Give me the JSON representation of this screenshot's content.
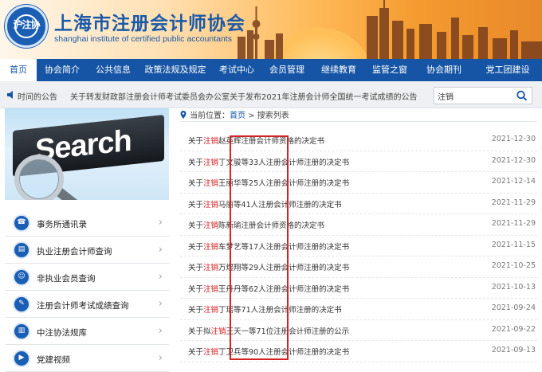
{
  "header": {
    "emblem_text": "沪注协",
    "title": "上海市注册会计师协会",
    "subtitle": "shanghai institute of certified public accountants",
    "colors": {
      "brand": "#1a5aa8",
      "banner_warm": "#f49a2e"
    }
  },
  "nav": {
    "items": [
      {
        "label": "首页",
        "active": true
      },
      {
        "label": "协会简介"
      },
      {
        "label": "公共信息"
      },
      {
        "label": "政策法规及规定"
      },
      {
        "label": "考试中心"
      },
      {
        "label": "会员管理"
      },
      {
        "label": "继续教育"
      },
      {
        "label": "监管之窗"
      },
      {
        "label": "协会期刊"
      },
      {
        "label": "党工团建设"
      }
    ],
    "bg_color": "#1655a5"
  },
  "notice": {
    "icon": "speaker-icon",
    "label": "时间的公告",
    "text": "关于转发财政部注册会计师考试委员会办公室关于发布2021年注册会计师全国统一考试成绩的公告"
  },
  "search": {
    "value": "注销",
    "icon": "search-icon"
  },
  "banner": {
    "word": "Search"
  },
  "left_menu": {
    "items": [
      {
        "label": "事务所通讯录",
        "icon": "address-book-icon",
        "glyph": "☎"
      },
      {
        "label": "执业注册会计师查询",
        "icon": "id-card-icon",
        "glyph": "▤"
      },
      {
        "label": "非执业会员查询",
        "icon": "user-icon",
        "glyph": "☺"
      },
      {
        "label": "注册会计师考试成绩查询",
        "icon": "document-icon",
        "glyph": "✎"
      },
      {
        "label": "中注协法规库",
        "icon": "book-icon",
        "glyph": "▥"
      },
      {
        "label": "党建视频",
        "icon": "video-icon",
        "glyph": "▶"
      }
    ]
  },
  "breadcrumb": {
    "prefix": "当前位置：",
    "home": "首页",
    "sep": " > ",
    "current": "搜索列表"
  },
  "results": {
    "highlight": "注销",
    "highlight_color": "#d41919",
    "items": [
      {
        "pre": "关于",
        "post": "赵英辉注册会计师资格的决定书",
        "date": "2021-12-30"
      },
      {
        "pre": "关于",
        "post": "丁文骏等33人注册会计师注册的决定书",
        "date": "2021-12-30"
      },
      {
        "pre": "关于",
        "post": "王丽华等25人注册会计师注册的决定书",
        "date": "2021-12-14"
      },
      {
        "pre": "关于",
        "post": "马丽等41人注册会计师注册的决定书",
        "date": "2021-11-29"
      },
      {
        "pre": "关于",
        "post": "陈新瑜注册会计师资格的决定书",
        "date": "2021-11-29"
      },
      {
        "pre": "关于",
        "post": "车梦艺等17人注册会计师注册的决定书",
        "date": "2021-11-15"
      },
      {
        "pre": "关于",
        "post": "万煜翔等29人注册会计师注册的决定书",
        "date": "2021-10-25"
      },
      {
        "pre": "关于",
        "post": "王丹丹等62人注册会计师注册的决定书",
        "date": "2021-10-13"
      },
      {
        "pre": "关于",
        "post": "丁瑶等71人注册会计师注册的决定书",
        "date": "2021-09-24"
      },
      {
        "pre": "关于拟",
        "post": "王天一等71位注册会计师注册的公示",
        "date": "2021-09-22"
      },
      {
        "pre": "关于",
        "post": "丁卫兵等90人注册会计师注册的决定书",
        "date": "2021-09-13"
      }
    ]
  },
  "annotation": {
    "color": "#d12424"
  }
}
